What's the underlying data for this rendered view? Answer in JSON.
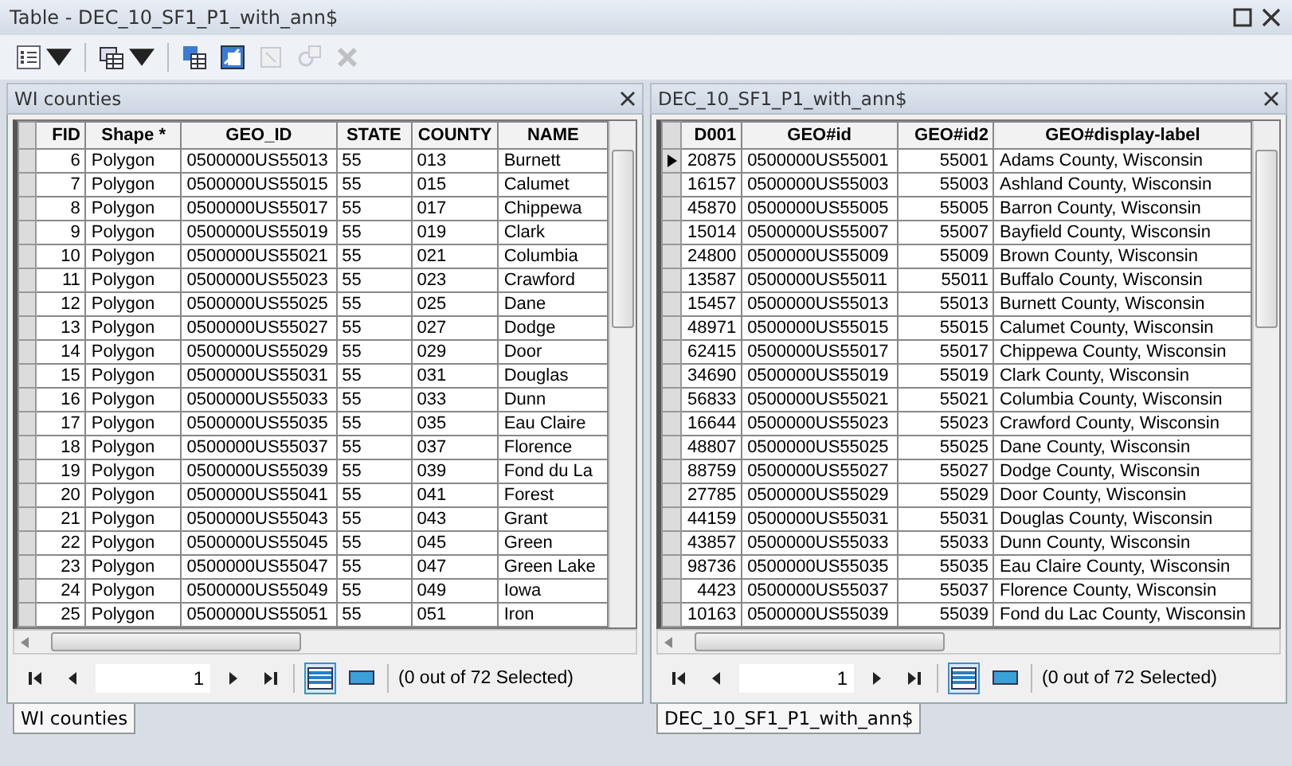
{
  "window": {
    "title": "Table - DEC_10_SF1_P1_with_ann$"
  },
  "toolbar": [
    {
      "kind": "options",
      "disabled": false,
      "dropdown": true
    },
    {
      "kind": "related",
      "disabled": false,
      "dropdown": true
    },
    {
      "kind": "select-by-attr",
      "disabled": false,
      "dropdown": false
    },
    {
      "kind": "switch-selection",
      "disabled": false,
      "dropdown": false
    },
    {
      "kind": "clear-selection",
      "disabled": true,
      "dropdown": false
    },
    {
      "kind": "zoom-selected",
      "disabled": true,
      "dropdown": false
    },
    {
      "kind": "delete",
      "disabled": true,
      "dropdown": false
    }
  ],
  "panes": [
    {
      "title": "WI counties",
      "columns": [
        {
          "label": "FID",
          "numeric": true
        },
        {
          "label": "Shape *",
          "numeric": false
        },
        {
          "label": "GEO_ID",
          "numeric": false
        },
        {
          "label": "STATE",
          "numeric": false
        },
        {
          "label": "COUNTY",
          "numeric": false
        },
        {
          "label": "NAME",
          "numeric": false
        }
      ],
      "rows": [
        {
          "cells": [
            "6",
            "Polygon",
            "0500000US55013",
            "55",
            "013",
            "Burnett"
          ],
          "current": false
        },
        {
          "cells": [
            "7",
            "Polygon",
            "0500000US55015",
            "55",
            "015",
            "Calumet"
          ],
          "current": false
        },
        {
          "cells": [
            "8",
            "Polygon",
            "0500000US55017",
            "55",
            "017",
            "Chippewa"
          ],
          "current": false
        },
        {
          "cells": [
            "9",
            "Polygon",
            "0500000US55019",
            "55",
            "019",
            "Clark"
          ],
          "current": false
        },
        {
          "cells": [
            "10",
            "Polygon",
            "0500000US55021",
            "55",
            "021",
            "Columbia"
          ],
          "current": false
        },
        {
          "cells": [
            "11",
            "Polygon",
            "0500000US55023",
            "55",
            "023",
            "Crawford"
          ],
          "current": false
        },
        {
          "cells": [
            "12",
            "Polygon",
            "0500000US55025",
            "55",
            "025",
            "Dane"
          ],
          "current": false
        },
        {
          "cells": [
            "13",
            "Polygon",
            "0500000US55027",
            "55",
            "027",
            "Dodge"
          ],
          "current": false
        },
        {
          "cells": [
            "14",
            "Polygon",
            "0500000US55029",
            "55",
            "029",
            "Door"
          ],
          "current": false
        },
        {
          "cells": [
            "15",
            "Polygon",
            "0500000US55031",
            "55",
            "031",
            "Douglas"
          ],
          "current": false
        },
        {
          "cells": [
            "16",
            "Polygon",
            "0500000US55033",
            "55",
            "033",
            "Dunn"
          ],
          "current": false
        },
        {
          "cells": [
            "17",
            "Polygon",
            "0500000US55035",
            "55",
            "035",
            "Eau Claire"
          ],
          "current": false
        },
        {
          "cells": [
            "18",
            "Polygon",
            "0500000US55037",
            "55",
            "037",
            "Florence"
          ],
          "current": false
        },
        {
          "cells": [
            "19",
            "Polygon",
            "0500000US55039",
            "55",
            "039",
            "Fond du La"
          ],
          "current": false
        },
        {
          "cells": [
            "20",
            "Polygon",
            "0500000US55041",
            "55",
            "041",
            "Forest"
          ],
          "current": false
        },
        {
          "cells": [
            "21",
            "Polygon",
            "0500000US55043",
            "55",
            "043",
            "Grant"
          ],
          "current": false
        },
        {
          "cells": [
            "22",
            "Polygon",
            "0500000US55045",
            "55",
            "045",
            "Green"
          ],
          "current": false
        },
        {
          "cells": [
            "23",
            "Polygon",
            "0500000US55047",
            "55",
            "047",
            "Green Lake"
          ],
          "current": false
        },
        {
          "cells": [
            "24",
            "Polygon",
            "0500000US55049",
            "55",
            "049",
            "Iowa"
          ],
          "current": false
        },
        {
          "cells": [
            "25",
            "Polygon",
            "0500000US55051",
            "55",
            "051",
            "Iron"
          ],
          "current": false
        }
      ],
      "page": "1",
      "views": [
        {
          "kind": "all",
          "selected": true
        },
        {
          "kind": "selected",
          "selected": false
        }
      ],
      "status": "(0 out of 72 Selected)"
    },
    {
      "title": "DEC_10_SF1_P1_with_ann$",
      "columns": [
        {
          "label": "D001",
          "numeric": true
        },
        {
          "label": "GEO#id",
          "numeric": false
        },
        {
          "label": "GEO#id2",
          "numeric": true
        },
        {
          "label": "GEO#display-label",
          "numeric": false
        }
      ],
      "rows": [
        {
          "cells": [
            "20875",
            "0500000US55001",
            "55001",
            "Adams County, Wisconsin"
          ],
          "current": true
        },
        {
          "cells": [
            "16157",
            "0500000US55003",
            "55003",
            "Ashland County, Wisconsin"
          ],
          "current": false
        },
        {
          "cells": [
            "45870",
            "0500000US55005",
            "55005",
            "Barron County, Wisconsin"
          ],
          "current": false
        },
        {
          "cells": [
            "15014",
            "0500000US55007",
            "55007",
            "Bayfield County, Wisconsin"
          ],
          "current": false
        },
        {
          "cells": [
            "24800",
            "0500000US55009",
            "55009",
            "Brown County, Wisconsin"
          ],
          "current": false
        },
        {
          "cells": [
            "13587",
            "0500000US55011",
            "55011",
            "Buffalo County, Wisconsin"
          ],
          "current": false
        },
        {
          "cells": [
            "15457",
            "0500000US55013",
            "55013",
            "Burnett County, Wisconsin"
          ],
          "current": false
        },
        {
          "cells": [
            "48971",
            "0500000US55015",
            "55015",
            "Calumet County, Wisconsin"
          ],
          "current": false
        },
        {
          "cells": [
            "62415",
            "0500000US55017",
            "55017",
            "Chippewa County, Wisconsin"
          ],
          "current": false
        },
        {
          "cells": [
            "34690",
            "0500000US55019",
            "55019",
            "Clark County, Wisconsin"
          ],
          "current": false
        },
        {
          "cells": [
            "56833",
            "0500000US55021",
            "55021",
            "Columbia County, Wisconsin"
          ],
          "current": false
        },
        {
          "cells": [
            "16644",
            "0500000US55023",
            "55023",
            "Crawford County, Wisconsin"
          ],
          "current": false
        },
        {
          "cells": [
            "48807",
            "0500000US55025",
            "55025",
            "Dane County, Wisconsin"
          ],
          "current": false
        },
        {
          "cells": [
            "88759",
            "0500000US55027",
            "55027",
            "Dodge County, Wisconsin"
          ],
          "current": false
        },
        {
          "cells": [
            "27785",
            "0500000US55029",
            "55029",
            "Door County, Wisconsin"
          ],
          "current": false
        },
        {
          "cells": [
            "44159",
            "0500000US55031",
            "55031",
            "Douglas County, Wisconsin"
          ],
          "current": false
        },
        {
          "cells": [
            "43857",
            "0500000US55033",
            "55033",
            "Dunn County, Wisconsin"
          ],
          "current": false
        },
        {
          "cells": [
            "98736",
            "0500000US55035",
            "55035",
            "Eau Claire County, Wisconsin"
          ],
          "current": false
        },
        {
          "cells": [
            "4423",
            "0500000US55037",
            "55037",
            "Florence County, Wisconsin"
          ],
          "current": false
        },
        {
          "cells": [
            "10163",
            "0500000US55039",
            "55039",
            "Fond du Lac County, Wisconsin"
          ],
          "current": false
        }
      ],
      "page": "1",
      "views": [
        {
          "kind": "all",
          "selected": true
        },
        {
          "kind": "selected",
          "selected": false
        }
      ],
      "status": "(0 out of 72 Selected)"
    }
  ],
  "bottom_tabs": [
    [
      {
        "label": "WI counties",
        "selected": true
      }
    ],
    [
      {
        "label": "DEC_10_SF1_P1_with_ann$",
        "selected": true
      }
    ]
  ]
}
